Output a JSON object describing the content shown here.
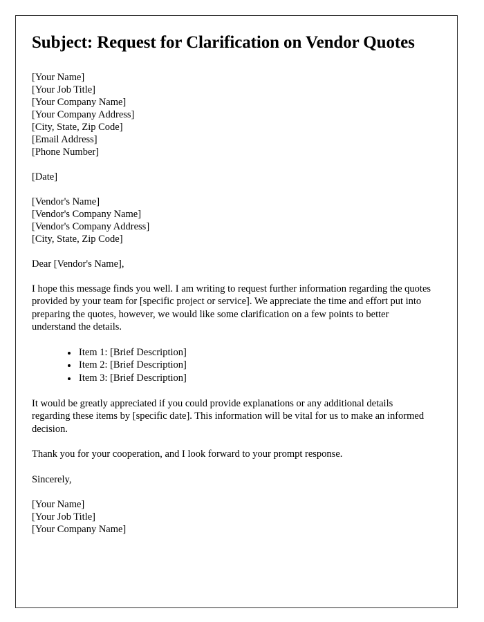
{
  "document": {
    "title": "Subject: Request for Clarification on Vendor Quotes",
    "sender_block": [
      "[Your Name]",
      "[Your Job Title]",
      "[Your Company Name]",
      "[Your Company Address]",
      "[City, State, Zip Code]",
      "[Email Address]",
      "[Phone Number]"
    ],
    "date_line": "[Date]",
    "recipient_block": [
      "[Vendor's Name]",
      "[Vendor's Company Name]",
      "[Vendor's Company Address]",
      "[City, State, Zip Code]"
    ],
    "salutation": "Dear [Vendor's Name],",
    "paragraph_intro": "I hope this message finds you well. I am writing to request further information regarding the quotes provided by your team for [specific project or service]. We appreciate the time and effort put into preparing the quotes, however, we would like some clarification on a few points to better understand the details.",
    "items": [
      "Item 1: [Brief Description]",
      "Item 2: [Brief Description]",
      "Item 3: [Brief Description]"
    ],
    "paragraph_request": "It would be greatly appreciated if you could provide explanations or any additional details regarding these items by [specific date]. This information will be vital for us to make an informed decision.",
    "paragraph_thanks": "Thank you for your cooperation, and I look forward to your prompt response.",
    "closing": "Sincerely,",
    "signature_block": [
      "[Your Name]",
      "[Your Job Title]",
      "[Your Company Name]"
    ]
  }
}
